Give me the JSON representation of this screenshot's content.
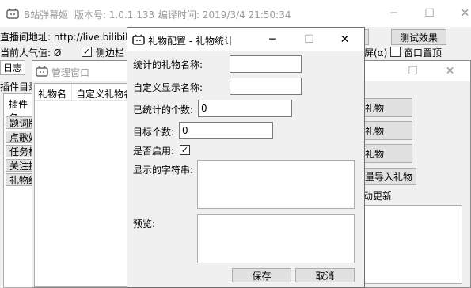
{
  "main": {
    "title": "B站弹幕姬",
    "version": "版本号: 1.0.1.133",
    "build": "编译时间: 2019/3/4 21:50:34",
    "room_label": "直播间地址: http://live.bilibili.",
    "popularity": "当前人气值: Ø",
    "sidebar_check": "侧边栏",
    "test_button": "测试效果",
    "screen_text": "屏(α)",
    "top_check": "窗口置顶",
    "log_tab": "日志",
    "plugin_dir": "插件目录",
    "plugin_header": "插件名",
    "plugin_items": [
      "题词版",
      "点歌姬",
      "任务栏",
      "关注提",
      "礼物统"
    ],
    "side_buttons": [
      "礼物",
      "礼物",
      "礼物"
    ],
    "import_button": "批量导入礼物",
    "auto_update": "自动更新"
  },
  "manager": {
    "title": "管理窗口",
    "col_gift": "礼物名",
    "col_alias": "自定义礼物名"
  },
  "dialog": {
    "title": "礼物配置 - 礼物统计",
    "gift_name_label": "统计的礼物名称:",
    "gift_name_value": "",
    "display_name_label": "自定义显示名称:",
    "display_name_value": "",
    "count_label": "已统计的个数:",
    "count_value": "0",
    "target_label": "目标个数:",
    "target_value": "0",
    "enabled_label": "是否启用:",
    "enabled": true,
    "display_string_label": "显示的字符串:",
    "preview_label": "预览:",
    "save": "保存",
    "cancel": "取消"
  },
  "icons": {
    "minimize": "─",
    "maximize": "☐",
    "close": "✕"
  },
  "colors": {
    "accent": "#0078d7",
    "icon": "#1e1e1e"
  }
}
